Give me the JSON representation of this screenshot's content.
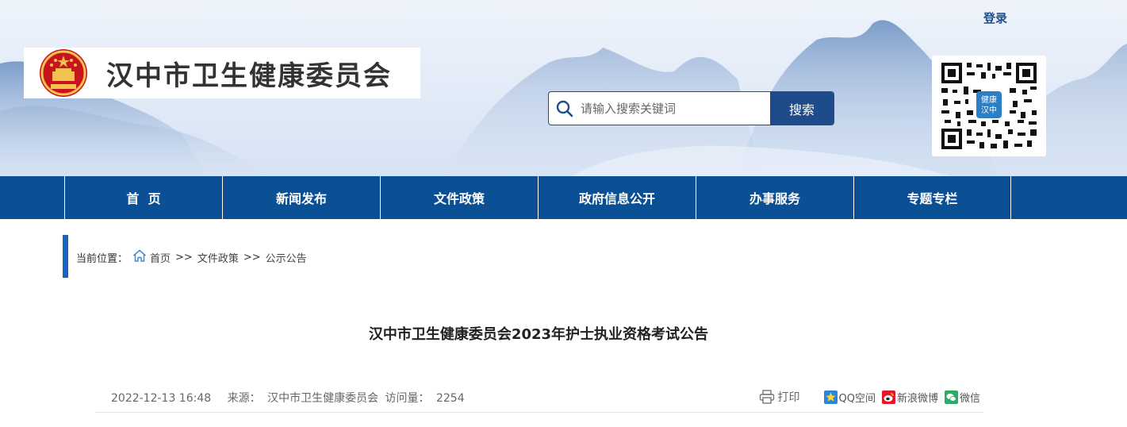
{
  "header": {
    "login_label": "登录",
    "site_title": "汉中市卫生健康委员会",
    "qr_badge": "健康汉中"
  },
  "search": {
    "placeholder": "请输入搜索关键词",
    "button_label": "搜索"
  },
  "nav": {
    "items": [
      {
        "label": "首  页"
      },
      {
        "label": "新闻发布"
      },
      {
        "label": "文件政策"
      },
      {
        "label": "政府信息公开"
      },
      {
        "label": "办事服务"
      },
      {
        "label": "专题专栏"
      }
    ]
  },
  "breadcrumb": {
    "prefix": "当前位置：",
    "items": [
      "首页",
      "文件政策",
      "公示公告"
    ],
    "separator": ">>"
  },
  "article": {
    "title": "汉中市卫生健康委员会2023年护士执业资格考试公告",
    "date": "2022-12-13 16:48",
    "source_label": "来源：",
    "source": "汉中市卫生健康委员会",
    "views_label": "访问量：",
    "views": "2254"
  },
  "tools": {
    "print_label": "打印",
    "share": [
      {
        "label": "QQ空间",
        "icon": "qzone-icon"
      },
      {
        "label": "新浪微博",
        "icon": "weibo-icon"
      },
      {
        "label": "微信",
        "icon": "wechat-icon"
      }
    ]
  },
  "colors": {
    "nav_bg": "#0b4f95",
    "search_btn": "#1e4c8a",
    "accent_bar": "#1565c0"
  }
}
